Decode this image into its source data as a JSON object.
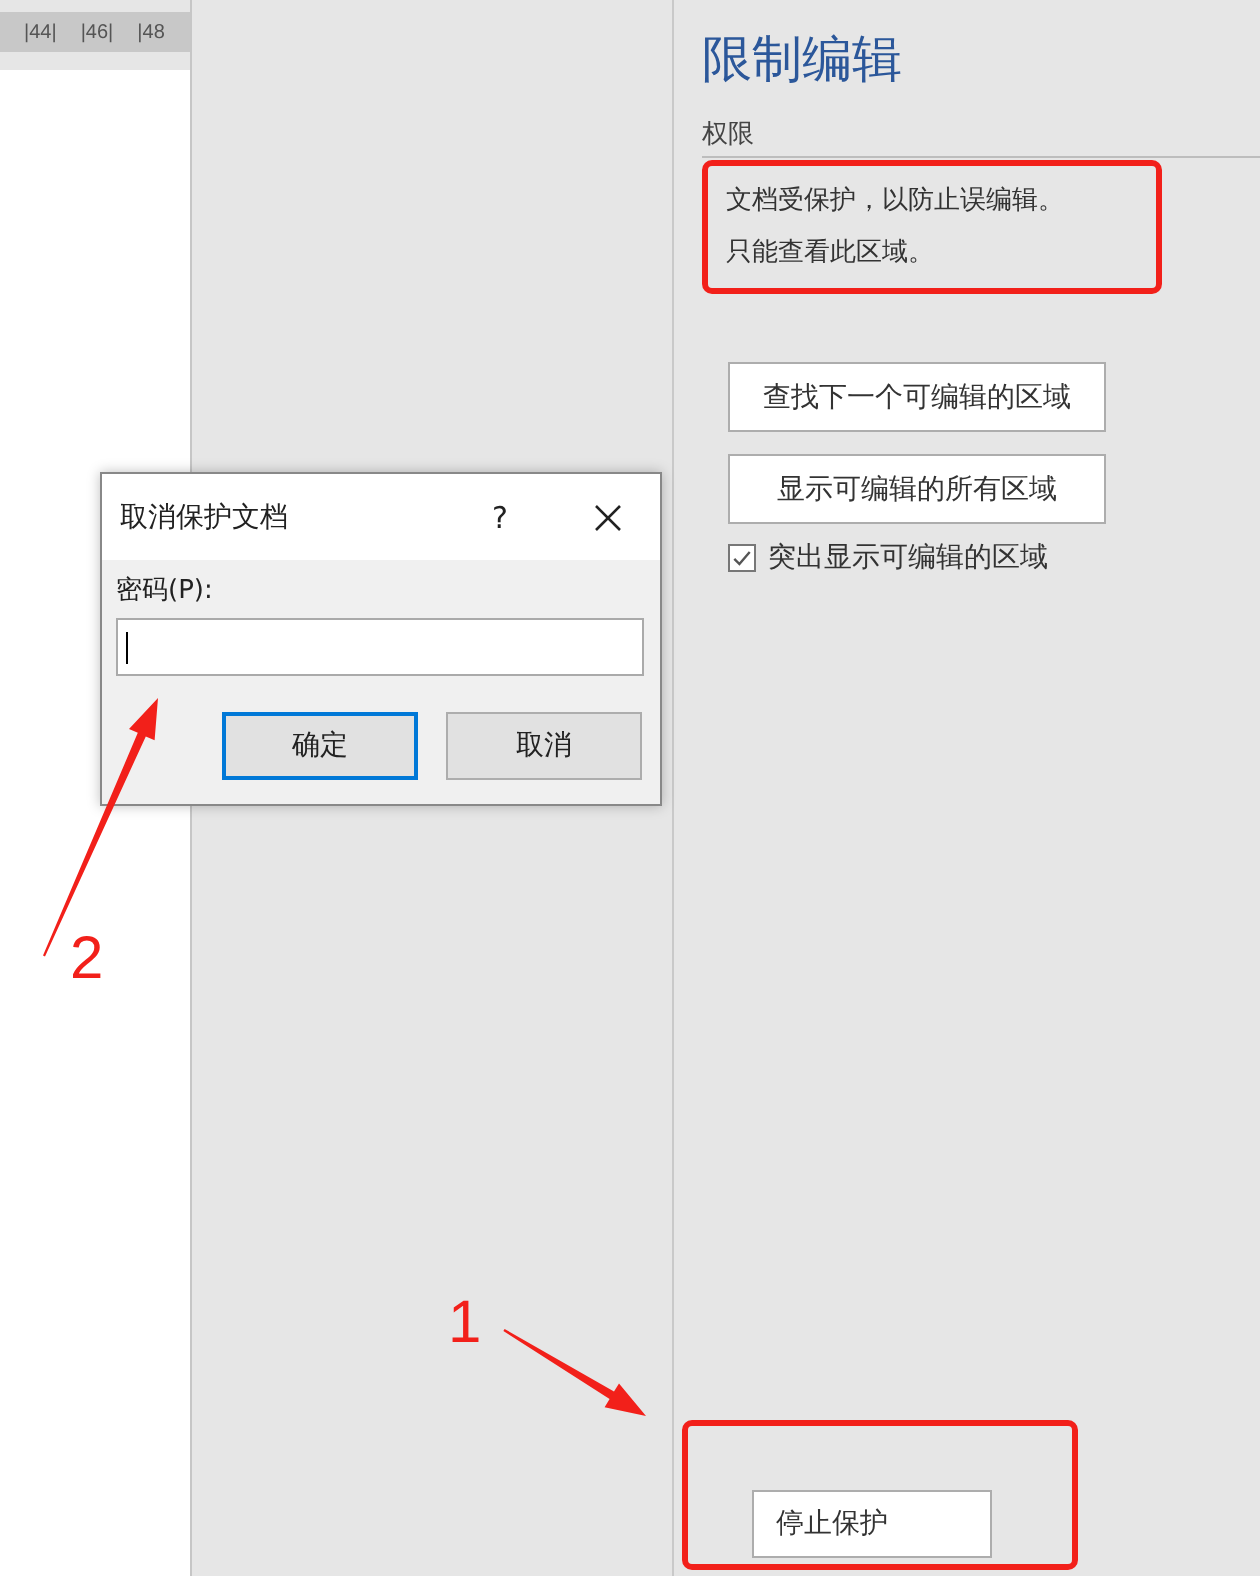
{
  "ruler": {
    "labels": [
      "|44|",
      "|46|",
      "|48"
    ]
  },
  "pane": {
    "title": "限制编辑",
    "section": "权限",
    "message": [
      "文档受保护，以防止误编辑。",
      "只能查看此区域。"
    ],
    "buttons": [
      "查找下一个可编辑的区域",
      "显示可编辑的所有区域"
    ],
    "highlight": {
      "label": "突出显示可编辑的区域",
      "checked": true
    },
    "stop_button": "停止保护"
  },
  "dialog": {
    "title": "取消保护文档",
    "help": "?",
    "field_label": "密码(P):",
    "buttons": [
      {
        "label": "确定",
        "default": true
      },
      {
        "label": "取消",
        "default": false
      }
    ]
  },
  "callouts": [
    {
      "number": "2"
    },
    {
      "number": "1"
    }
  ]
}
